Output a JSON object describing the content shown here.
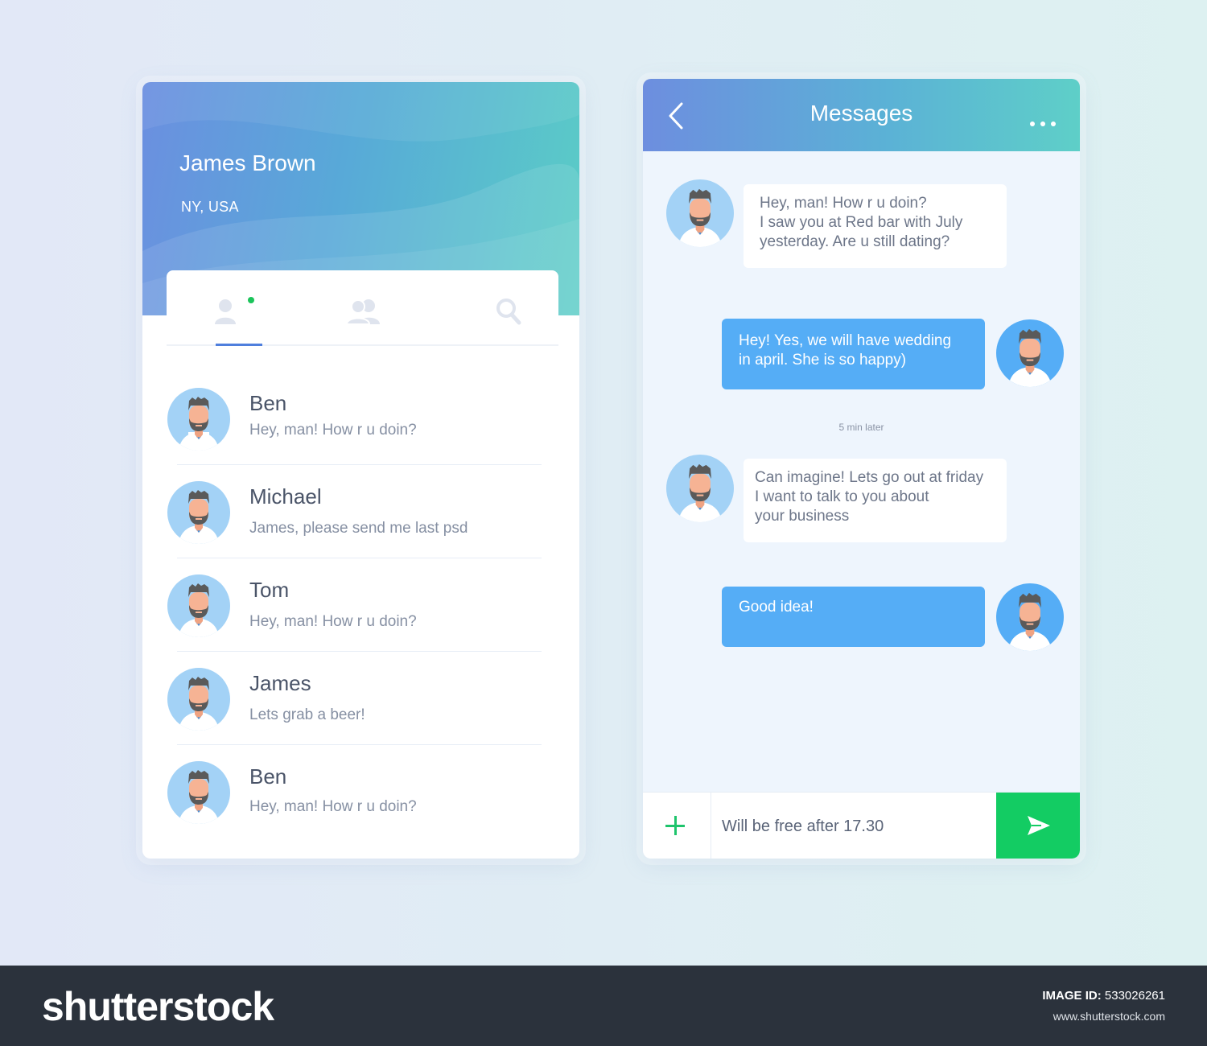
{
  "profile": {
    "name": "James Brown",
    "location": "NY, USA"
  },
  "tabs": [
    {
      "icon": "person-icon",
      "active": true
    },
    {
      "icon": "group-icon",
      "active": false
    },
    {
      "icon": "search-icon",
      "active": false
    }
  ],
  "contacts": [
    {
      "name": "Ben",
      "preview": "Hey, man! How r u doin?"
    },
    {
      "name": "Michael",
      "preview": "James, please send me last psd"
    },
    {
      "name": "Tom",
      "preview": "Hey, man! How r u doin?"
    },
    {
      "name": "James",
      "preview": "Lets grab a beer!"
    },
    {
      "name": "Ben",
      "preview": "Hey, man! How r u doin?"
    }
  ],
  "chat": {
    "title": "Messages",
    "messages": [
      {
        "direction": "incoming",
        "lines": [
          "Hey, man! How r u doin?",
          "I saw you at Red bar with July",
          "yesterday. Are u still dating?"
        ]
      },
      {
        "direction": "outgoing",
        "lines": [
          "Hey! Yes, we will have wedding",
          "in april. She is so happy)"
        ]
      },
      {
        "direction": "incoming",
        "lines": [
          "Can imagine! Lets go out at friday",
          "I want to talk to you about",
          "your business"
        ]
      },
      {
        "direction": "outgoing",
        "lines": [
          "Good idea!"
        ]
      }
    ],
    "timestamp": "5 min later",
    "composer_value": "Will be free after 17.30"
  },
  "colors": {
    "accent_blue": "#55adf6",
    "send_green": "#13cc63",
    "online_green": "#1bc45a",
    "tab_indicator": "#4f7fdd"
  },
  "footer": {
    "brand": "shutterstock",
    "image_id_label": "IMAGE ID:",
    "image_id": "533026261",
    "url": "www.shutterstock.com"
  }
}
